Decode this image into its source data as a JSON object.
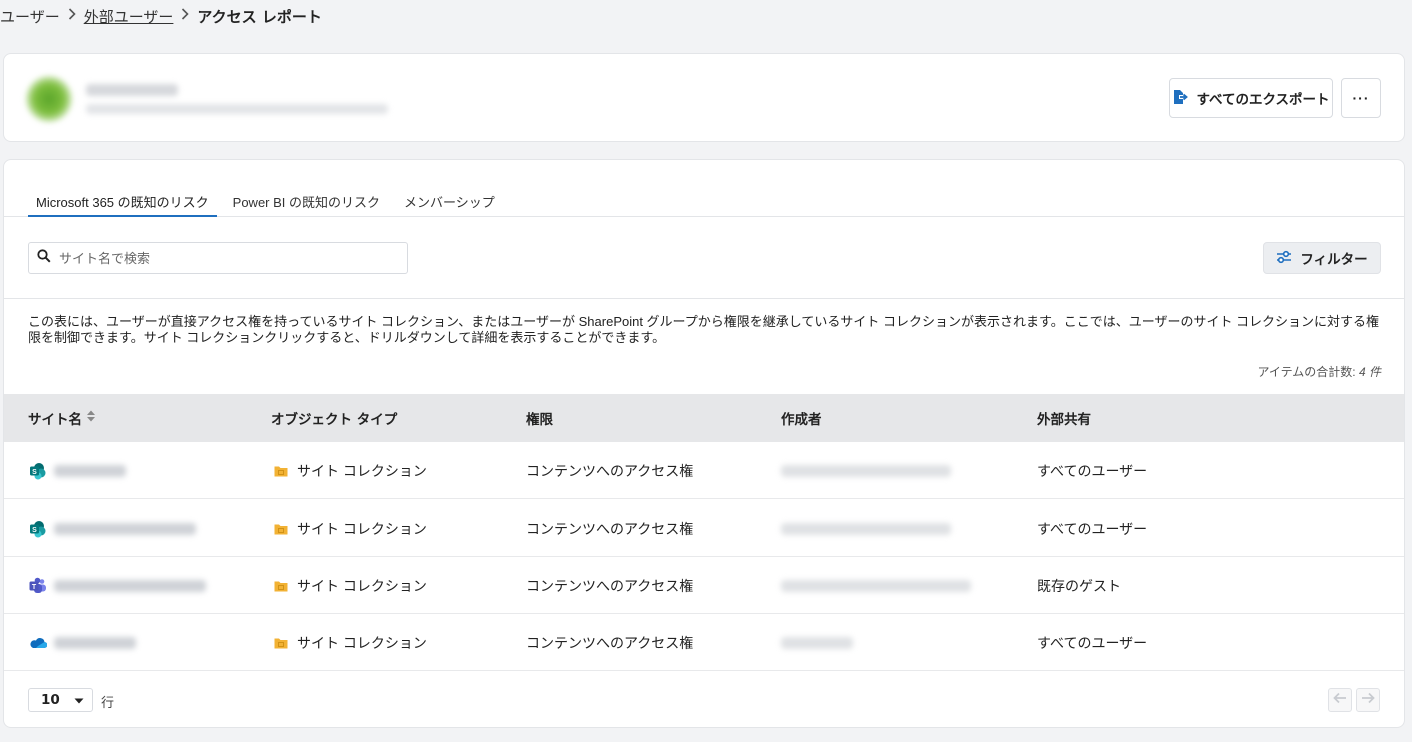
{
  "breadcrumb": {
    "items": [
      "ユーザー",
      "外部ユーザー"
    ],
    "current": "アクセス レポート"
  },
  "header": {
    "export_label": "すべてのエクスポート",
    "more_label": "···"
  },
  "tabs": [
    {
      "label": "Microsoft 365 の既知のリスク",
      "active": true
    },
    {
      "label": "Power BI の既知のリスク",
      "active": false
    },
    {
      "label": "メンバーシップ",
      "active": false
    }
  ],
  "search": {
    "placeholder": "サイト名で検索"
  },
  "filter_label": "フィルター",
  "description": "この表には、ユーザーが直接アクセス権を持っているサイト コレクション、またはユーザーが SharePoint グループから権限を継承しているサイト コレクションが表示されます。ここでは、ユーザーのサイト コレクションに対する権限を制御できます。サイト コレクションクリックすると、ドリルダウンして詳細を表示することができます。",
  "total": {
    "label": "アイテムの合計数:",
    "value": "4 件"
  },
  "table": {
    "columns": [
      "サイト名",
      "オブジェクト タイプ",
      "権限",
      "作成者",
      "外部共有"
    ],
    "rows": [
      {
        "site_icon": "sharepoint-icon",
        "object_type": "サイト コレクション",
        "permission": "コンテンツへのアクセス権",
        "sharing": "すべてのユーザー"
      },
      {
        "site_icon": "sharepoint-icon",
        "object_type": "サイト コレクション",
        "permission": "コンテンツへのアクセス権",
        "sharing": "すべてのユーザー"
      },
      {
        "site_icon": "teams-icon",
        "object_type": "サイト コレクション",
        "permission": "コンテンツへのアクセス権",
        "sharing": "既存のゲスト"
      },
      {
        "site_icon": "onedrive-icon",
        "object_type": "サイト コレクション",
        "permission": "コンテンツへのアクセス権",
        "sharing": "すべてのユーザー"
      }
    ]
  },
  "footer": {
    "rows_per_page": "10",
    "rows_label": "行"
  },
  "colors": {
    "accent": "#1f6fbf",
    "folder": "#f2b234",
    "sharepoint": "#038387",
    "teams": "#5b5fc7",
    "onedrive": "#0f6cbd"
  }
}
